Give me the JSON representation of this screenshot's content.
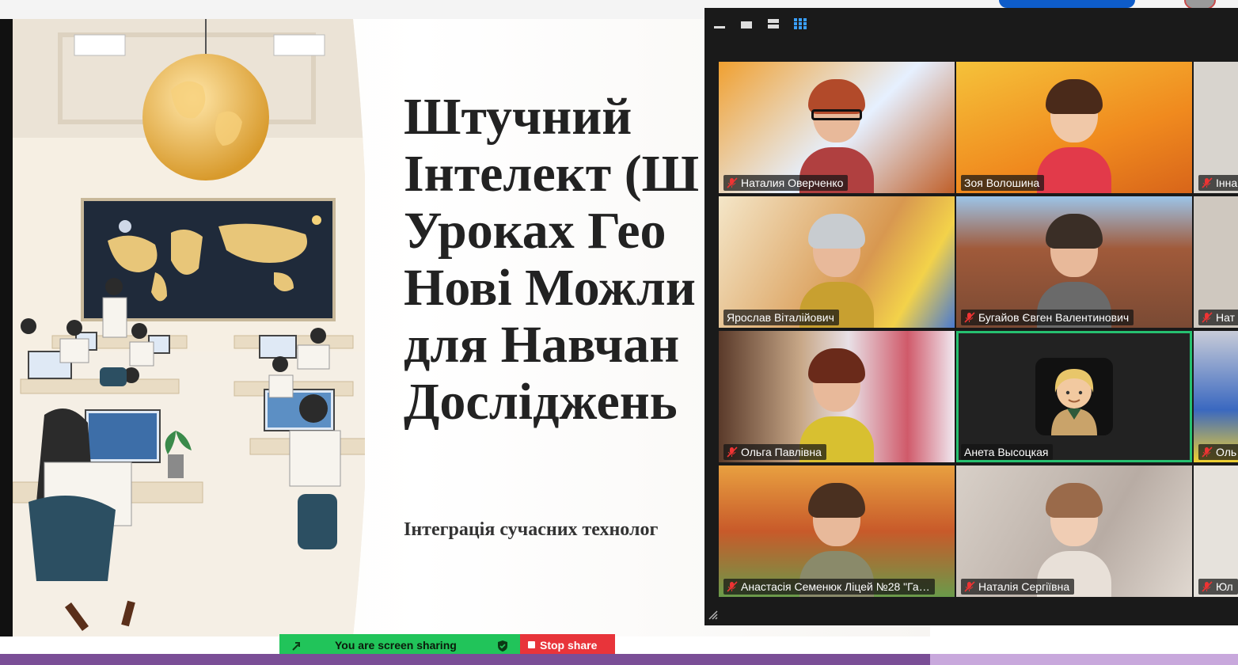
{
  "slide": {
    "title_lines": "Штучний\nІнтелект (Ш\nУроках Гео\nНові Можли\nдля Навчан\nДосліджень",
    "subtitle": "Інтеграція сучасних технолог"
  },
  "zoom": {
    "toolbar_icons": [
      "minimize-icon",
      "window-icon",
      "speaker-view-icon",
      "gallery-view-icon"
    ],
    "active_color": "#26c070",
    "participants": [
      {
        "name": "Наталия Оверченко",
        "muted": true
      },
      {
        "name": "Зоя Волошина",
        "muted": false
      },
      {
        "name": "Інна",
        "muted": true
      },
      {
        "name": "Ярослав Віталійович",
        "muted": false
      },
      {
        "name": "Бугайов Євген Валентинович",
        "muted": true
      },
      {
        "name": "Нат",
        "muted": true
      },
      {
        "name": "Ольга Павлівна",
        "muted": true
      },
      {
        "name": "Анета Высоцкая",
        "muted": false,
        "active_speaker": true
      },
      {
        "name": "Оль",
        "muted": true
      },
      {
        "name": "Анастасія Семенюк Ліцей №28 \"Га…",
        "muted": true
      },
      {
        "name": "Наталія Сергіївна",
        "muted": true
      },
      {
        "name": "Юл",
        "muted": true
      }
    ]
  },
  "share_bar": {
    "status": "You are screen sharing",
    "stop_label": "Stop share",
    "status_color": "#21c45a",
    "stop_color": "#e8343a"
  }
}
